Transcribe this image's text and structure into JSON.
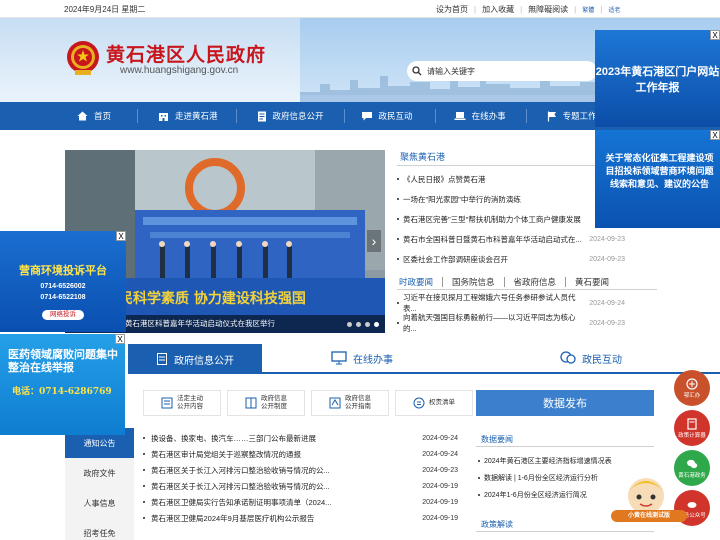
{
  "topbar": {
    "date": "2024年9月24日 星期二",
    "links": [
      "设为首页",
      "加入收藏",
      "無障礙阅读"
    ],
    "small_links": [
      "繁體",
      "适老"
    ]
  },
  "header": {
    "title": "黄石港区人民政府",
    "url": "www.huangshigang.gov.cn",
    "search_placeholder": "请输入关键字"
  },
  "nav": {
    "items": [
      {
        "label": "首页",
        "icon": "home-icon"
      },
      {
        "label": "走进黄石港",
        "icon": "building-icon"
      },
      {
        "label": "政府信息公开",
        "icon": "doc-icon"
      },
      {
        "label": "政民互动",
        "icon": "chat-icon"
      },
      {
        "label": "在线办事",
        "icon": "laptop-icon"
      },
      {
        "label": "专题工作",
        "icon": "flag-icon"
      }
    ]
  },
  "slider": {
    "caption": "黄石港区科普嘉年华活动启动仪式在我区举行"
  },
  "focus": {
    "tab": "聚焦黄石港",
    "items": [
      {
        "title": "《人民日报》点赞黄石港",
        "date": ""
      },
      {
        "title": "一场在\"阳光家园\"中举行的消防演练",
        "date": ""
      },
      {
        "title": "黄石港区完善\"三型\"帮扶机制助力个体工商户健康发展",
        "date": ""
      },
      {
        "title": "黄石市全国科普日暨黄石市科普嘉年华活动启动式在...",
        "date": "2024-09-23"
      },
      {
        "title": "区委社会工作部调研座谈会召开",
        "date": "2024-09-23"
      }
    ]
  },
  "tabs2": {
    "items": [
      "时政要闻",
      "国务院信息",
      "省政府信息",
      "黄石要闻"
    ]
  },
  "list2": {
    "items": [
      {
        "title": "习近平在接见探月工程嫦娥六号任务参研参试人员代表...",
        "date": "2024-09-24"
      },
      {
        "title": "向着航天强国目标勇毅前行——以习近平同志为核心的...",
        "date": "2024-09-23"
      }
    ]
  },
  "sections": {
    "tabs": [
      "政府信息公开",
      "在线办事",
      "政民互动"
    ]
  },
  "gov": {
    "side_tabs": [
      "通知公告",
      "政府文件",
      "人事信息",
      "招考任免"
    ],
    "icon_buttons": [
      {
        "label": "法定主动\n公开内容",
        "icon": "stamp-icon"
      },
      {
        "label": "政府信息\n公开制度",
        "icon": "book-icon"
      },
      {
        "label": "政府信息\n公开指南",
        "icon": "guide-icon"
      },
      {
        "label": "权责清单",
        "icon": "list-icon"
      }
    ],
    "notices": [
      {
        "title": "换设备、换家电、换汽车……三部门公布最新进展",
        "date": "2024-09-24"
      },
      {
        "title": "黄石港区审计局党组关于巡察整改情况的通报",
        "date": "2024-09-24"
      },
      {
        "title": "黄石港区关于长江入河排污口整治验收销号情况的公...",
        "date": "2024-09-23"
      },
      {
        "title": "黄石港区关于长江入河排污口整治验收销号情况的公...",
        "date": "2024-09-19"
      },
      {
        "title": "黄石港区卫健局实行告知承诺制证明事项清单（2024...",
        "date": "2024-09-19"
      },
      {
        "title": "黄石港区卫健局2024年9月基层医疗机构公示报告",
        "date": "2024-09-19"
      }
    ]
  },
  "release": {
    "label": "数据发布",
    "sub1": "数据要闻",
    "items": [
      "2024年黄石港区主要经济指标增速情况表",
      "数据解读 | 1-6月份全区经济运行分析",
      "2024年1-6月份全区经济运行简况"
    ],
    "sub2": "政策解读"
  },
  "ads": {
    "right1": "2023年黄石港区门户网站工作年报",
    "right2": "关于常态化征集工程建设项目招投标领域营商环境问题线索和意见、建议的公告",
    "left1_title": "营商环境投诉平台",
    "left1_phones": [
      "0714-6526002",
      "0714-6522108"
    ],
    "left1_button": "网络投诉",
    "left2_title": "医药领域腐败问题集中整治在线举报",
    "left2_phone": "电话：0714-6286769",
    "close": "X"
  },
  "right_sidebar": {
    "items": [
      "鄂汇办",
      "政策计算器",
      "黄石港政务",
      "政务公众号"
    ]
  },
  "mascot": {
    "label": "小黄在线测试版"
  },
  "colors": {
    "primary": "#1a5fb0",
    "title_red": "#c8161d"
  }
}
